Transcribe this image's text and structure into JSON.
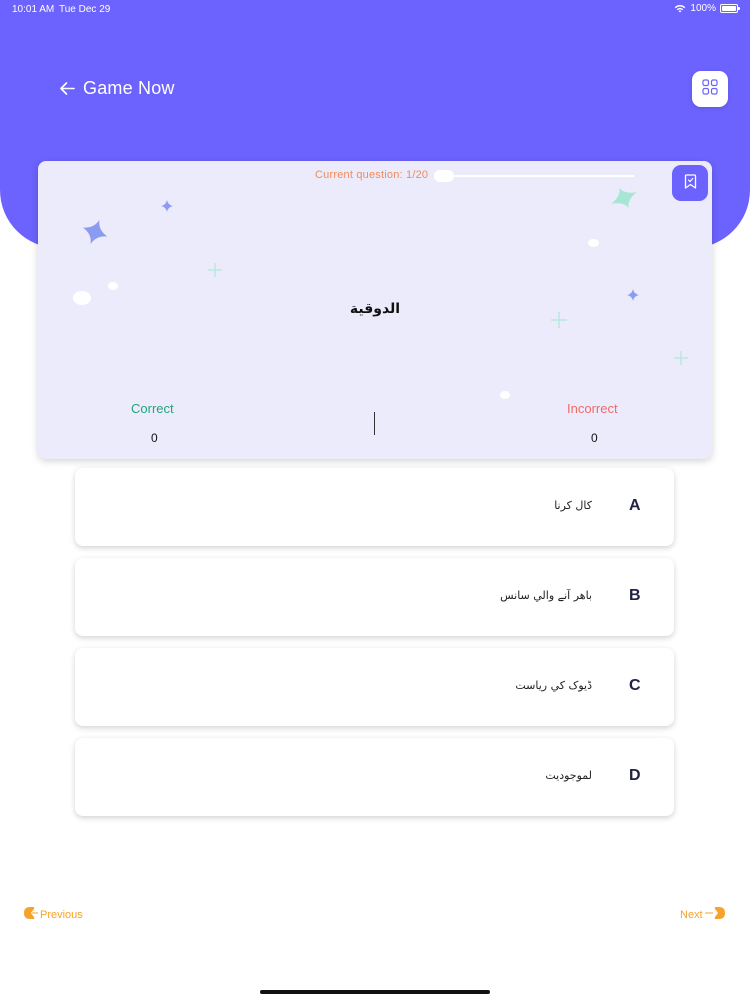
{
  "status_bar": {
    "time": "10:01 AM",
    "date": "Tue Dec 29",
    "battery": "100%"
  },
  "header": {
    "title": "Game Now",
    "back_icon": "arrow-left-icon",
    "menu_icon": "grid-icon",
    "background_color": "#6c63ff"
  },
  "question_card": {
    "progress_label": "Current question: 1/20",
    "progress_fraction": 0.05,
    "word": "الدوقية",
    "bookmark_icon": "bookmark-icon",
    "correct_label": "Correct",
    "correct_value": "0",
    "incorrect_label": "Incorrect",
    "incorrect_value": "0"
  },
  "options": [
    {
      "letter": "A",
      "text": "کال کرنا"
    },
    {
      "letter": "B",
      "text": "باهر آنے والي سانس"
    },
    {
      "letter": "C",
      "text": "ڈیوک کي رياست"
    },
    {
      "letter": "D",
      "text": "لموجوديت"
    }
  ],
  "nav": {
    "previous_label": "Previous",
    "next_label": "Next",
    "accent_color": "#f6a32b"
  }
}
